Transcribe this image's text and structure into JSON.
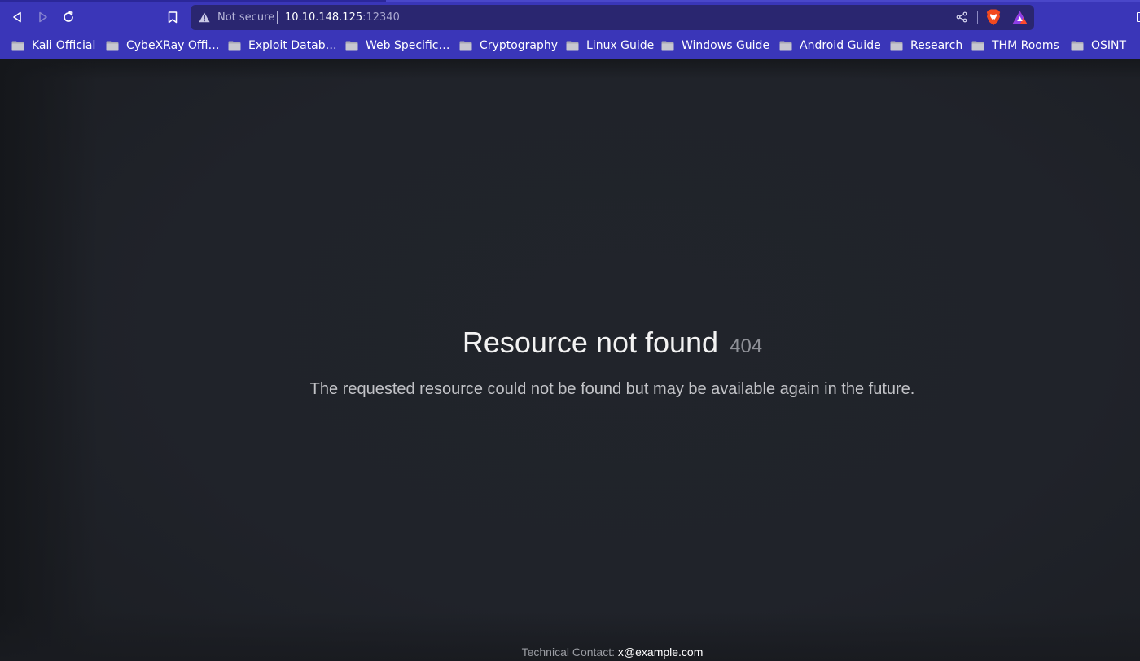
{
  "browser": {
    "address_bar": {
      "security_label": "Not secure",
      "url_host": "10.10.148.125",
      "url_port": ":12340"
    },
    "icons": {
      "back": "back-arrow-icon",
      "forward": "forward-arrow-icon",
      "reload": "reload-icon",
      "bookmark": "bookmark-icon",
      "security": "warning-triangle-icon",
      "share": "share-icon",
      "shield": "brave-shields-icon",
      "rewards": "brave-rewards-icon"
    },
    "bookmarks": [
      {
        "label": "Kali Official"
      },
      {
        "label": "CybeXRay Offi…"
      },
      {
        "label": "Exploit Datab…"
      },
      {
        "label": "Web Specific…"
      },
      {
        "label": "Cryptography"
      },
      {
        "label": "Linux Guide"
      },
      {
        "label": "Windows Guide"
      },
      {
        "label": "Android Guide"
      },
      {
        "label": "Research"
      },
      {
        "label": "THM Rooms"
      },
      {
        "label": "OSINT"
      }
    ],
    "colors": {
      "chrome": "#3a36b8",
      "address_bar": "#2a2670",
      "page_background": "#1f2127"
    }
  },
  "page": {
    "heading": "Resource not found",
    "status_code": "404",
    "message": "The requested resource could not be found but may be available again in the future.",
    "footer": {
      "contact_label": "Technical Contact:",
      "contact_email": "x@example.com"
    }
  }
}
